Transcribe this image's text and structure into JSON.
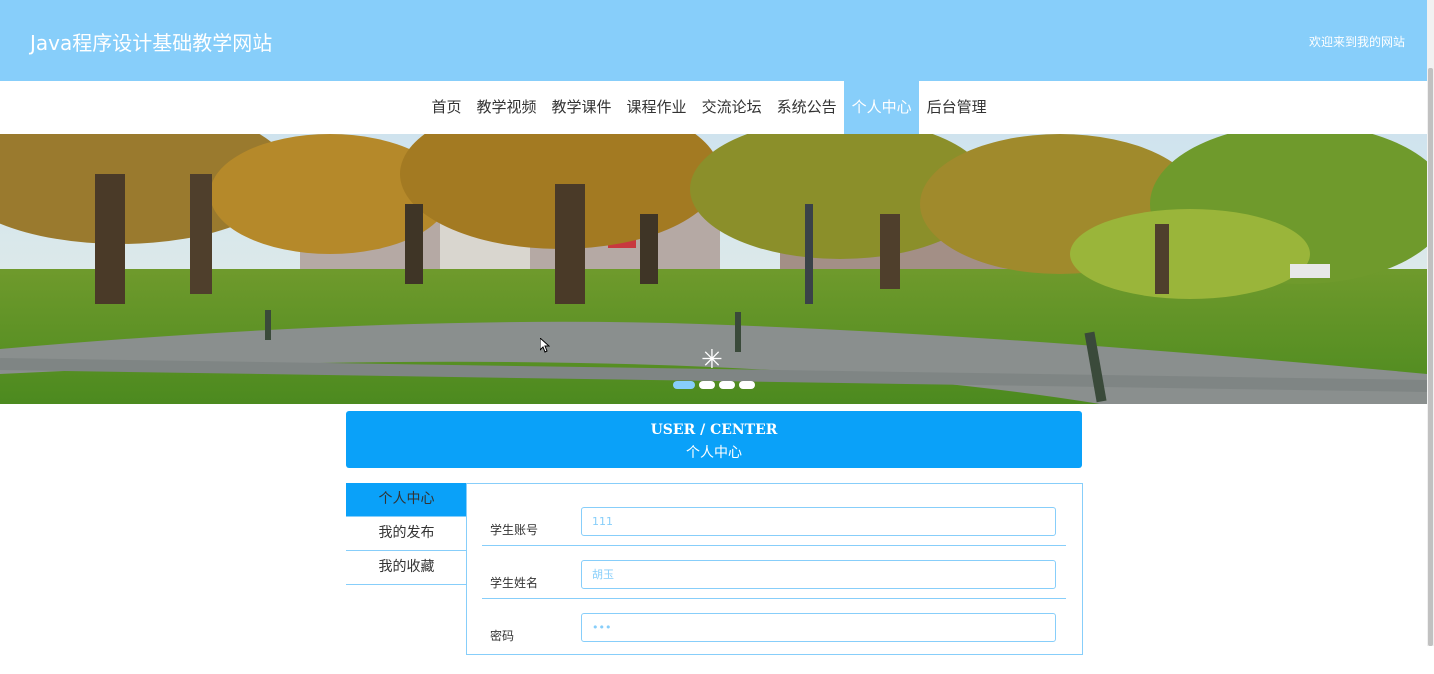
{
  "header": {
    "title": "Java程序设计基础教学网站",
    "welcome": "欢迎来到我的网站"
  },
  "nav": {
    "items": [
      "首页",
      "教学视频",
      "教学课件",
      "课程作业",
      "交流论坛",
      "系统公告",
      "个人中心",
      "后台管理"
    ],
    "active": "个人中心"
  },
  "banner": {
    "slide_count": 4,
    "active_slide": 1
  },
  "user_center": {
    "title_en": "USER / CENTER",
    "title_cn": "个人中心"
  },
  "sidebar": {
    "items": [
      "个人中心",
      "我的发布",
      "我的收藏"
    ],
    "active": "个人中心"
  },
  "form": {
    "fields": [
      {
        "label": "学生账号",
        "value": "111"
      },
      {
        "label": "学生姓名",
        "value": "胡玉"
      },
      {
        "label": "密码",
        "value": "•••"
      }
    ]
  },
  "colors": {
    "header_bg": "#87cefa",
    "accent_blue": "#0aa1f9"
  }
}
